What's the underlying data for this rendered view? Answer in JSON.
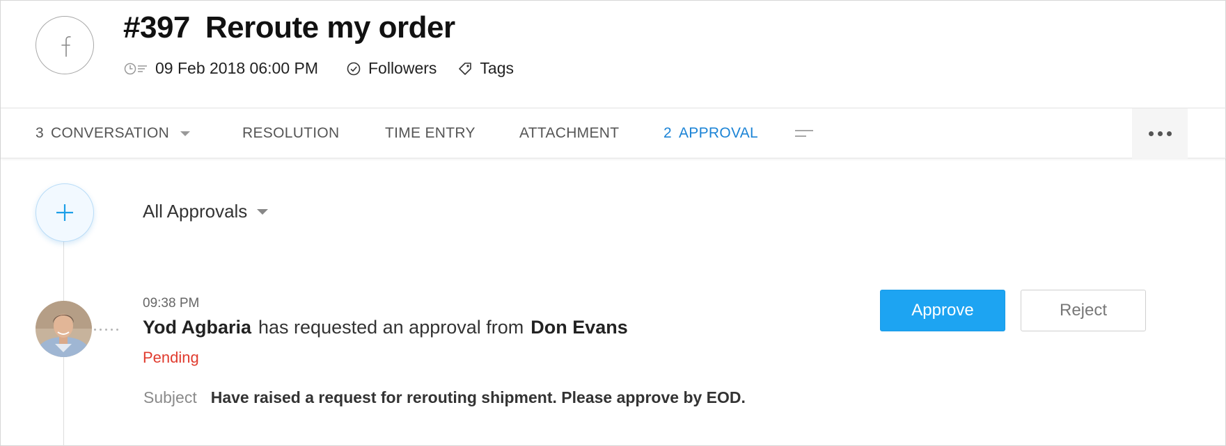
{
  "ticket": {
    "number": "#397",
    "subject": "Reroute my order",
    "channel_icon": "facebook-icon",
    "date": "09 Feb 2018 06:00 PM",
    "followers_label": "Followers",
    "tags_label": "Tags"
  },
  "tabs": [
    {
      "count": "3",
      "label": "CONVERSATION",
      "has_dropdown": true,
      "active": false
    },
    {
      "count": "",
      "label": "RESOLUTION",
      "active": false
    },
    {
      "count": "",
      "label": "TIME ENTRY",
      "active": false
    },
    {
      "count": "",
      "label": "ATTACHMENT",
      "active": false
    },
    {
      "count": "2",
      "label": "APPROVAL",
      "active": true
    }
  ],
  "approvals": {
    "filter_label": "All Approvals",
    "items": [
      {
        "time": "09:38 PM",
        "requester": "Yod Agbaria",
        "action_text": "has requested an approval from",
        "approver": "Don Evans",
        "status": "Pending",
        "subject_label": "Subject",
        "subject": "Have raised a request for rerouting shipment. Please approve by EOD.",
        "approve_label": "Approve",
        "reject_label": "Reject"
      }
    ]
  },
  "colors": {
    "accent": "#1c84d6",
    "approve_button": "#1da4f2",
    "pending": "#e03b2e"
  }
}
